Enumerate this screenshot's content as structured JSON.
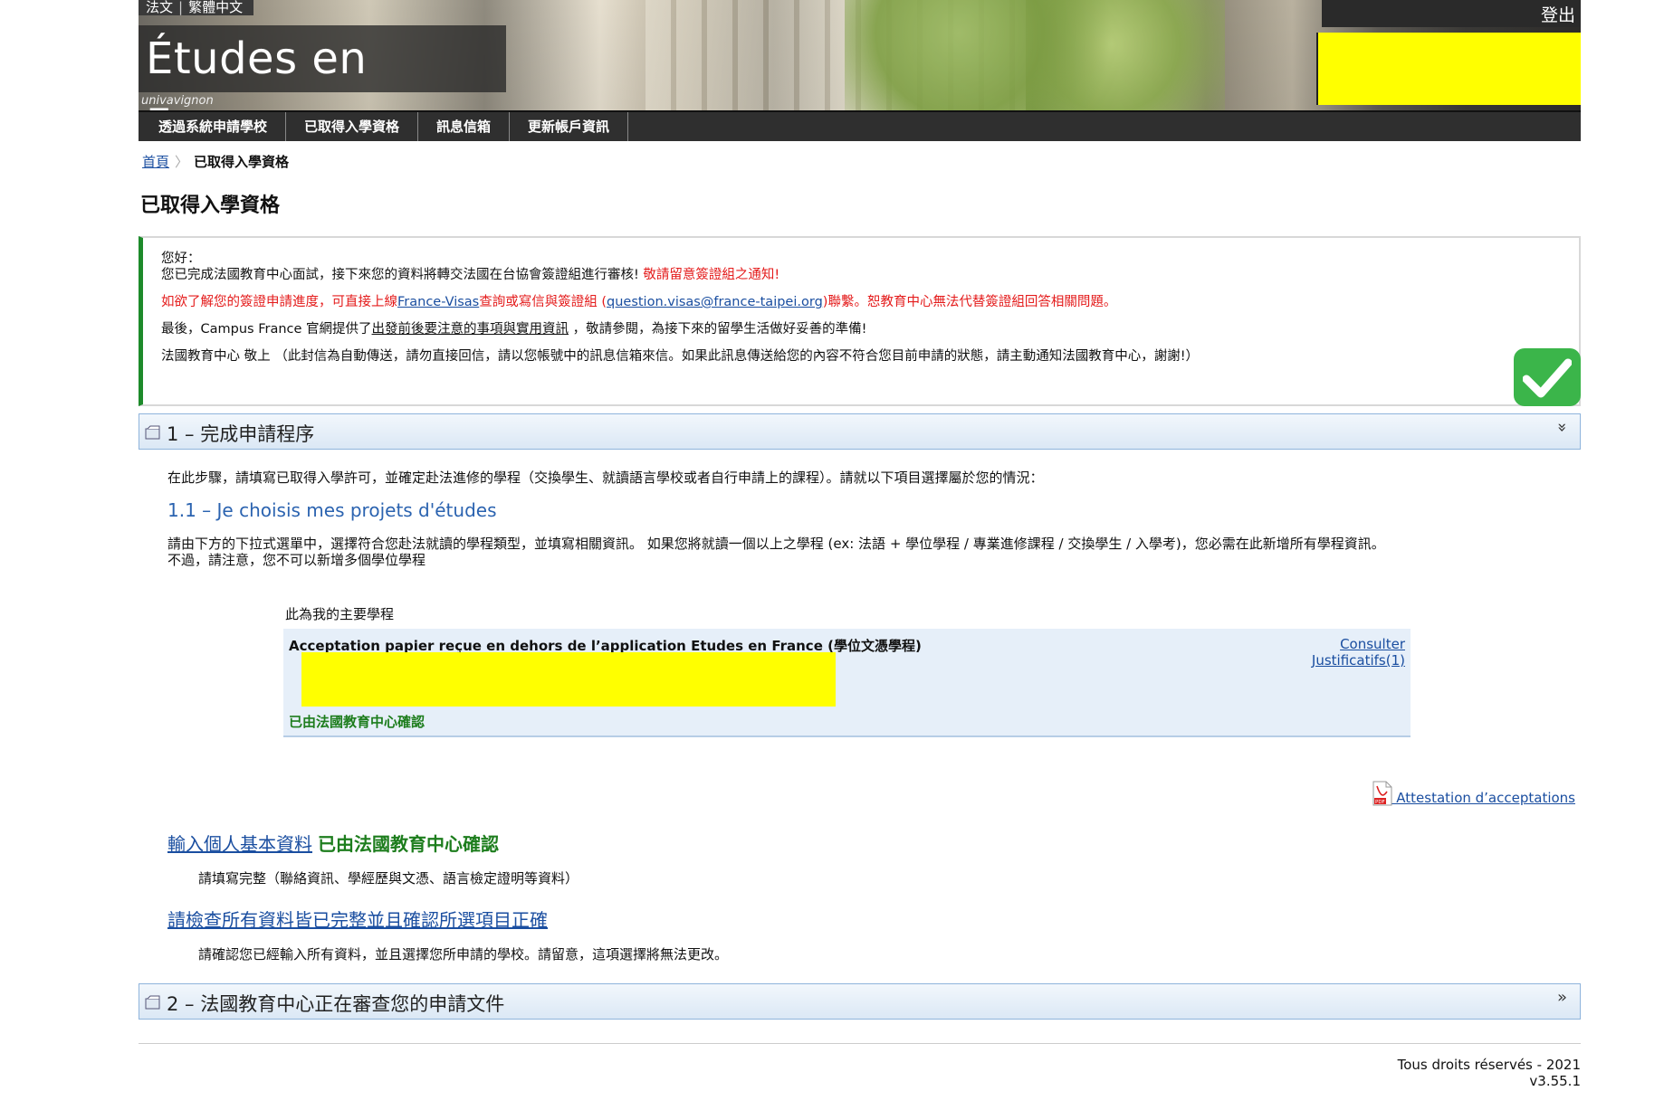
{
  "header": {
    "languages": [
      "法文",
      "繁體中文"
    ],
    "site_title": "Études en France",
    "site_subtitle": "univavignon",
    "logout_label": "登出"
  },
  "nav": {
    "items": [
      "透過系統申請學校",
      "已取得入學資格",
      "訊息信箱",
      "更新帳戶資訊"
    ]
  },
  "breadcrumb": {
    "home": "首頁",
    "current": "已取得入學資格"
  },
  "page_title": "已取得入學資格",
  "message": {
    "greeting": "您好：",
    "line1": "您已完成法國教育中心面試，接下來您的資料將轉交法國在台協會簽證組進行審核! ",
    "line1_red": "敬請留意簽證組之通知!",
    "line2_pre": "如欲了解您的簽證申請進度，可直接上線",
    "line2_link1": "France-Visas",
    "line2_mid": "查詢或寫信與簽證組 (",
    "line2_link2": "question.visas@france-taipei.org",
    "line2_post": ")聯繫。恕教育中心無法代替簽證組回答相關問題。",
    "line3_pre": "最後，Campus France 官網提供了",
    "line3_link": "出發前後要注意的事項與實用資訊",
    "line3_post": " ，敬請參閱，為接下來的留學生活做好妥善的準備!",
    "line4": "法國教育中心 敬上 （此封信為自動傳送，請勿直接回信，請以您帳號中的訊息信箱來信。如果此訊息傳送給您的內容不符合您目前申請的狀態，請主動通知法國教育中心，謝謝!）"
  },
  "section1": {
    "title": "1 – 完成申請程序",
    "chevron": "»",
    "intro": "在此步驟，請填寫已取得入學許可，並確定赴法進修的學程（交換學生、就讀語言學校或者自行申請上的課程）。請就以下項目選擇屬於您的情況：",
    "subheading": "1.1 – Je choisis mes projets d'études",
    "desc_line1": "請由下方的下拉式選單中，選擇符合您赴法就讀的學程類型，並填寫相關資訊。 如果您將就讀一個以上之學程 (ex: 法語 + 學位學程 / 專業進修課程 / 交換學生 / 入學考)，您必需在此新增所有學程資訊。",
    "desc_line2": "不過，請注意，您不可以新增多個學位學程",
    "main_program_label": "此為我的主要學程",
    "program": {
      "title": "Acceptation papier reçue en dehors de l’application Etudes en France (學位文憑學程)",
      "status": "已由法國教育中心確認",
      "link_consult": "Consulter",
      "link_justif": "Justificatifs(1)"
    },
    "attestation_link": " Attestation d’acceptations",
    "personal_info_link": "輸入個人基本資料",
    "personal_info_status": "已由法國教育中心確認",
    "personal_info_desc": "請填寫完整（聯絡資訊、學經歷與文憑、語言檢定證明等資料）",
    "check_link": "請檢查所有資料皆已完整並且確認所選項目正確",
    "check_desc": "請確認您已經輸入所有資料，並且選擇您所申請的學校。請留意，這項選擇將無法更改。"
  },
  "section2": {
    "title": "2 – 法國教育中心正在審查您的申請文件",
    "chevron": "»"
  },
  "footer": {
    "rights": "Tous droits réservés - 2021",
    "version": "v3.55.1"
  },
  "colors": {
    "accent_link": "#1a4ea0",
    "success_green": "#1d7d1d",
    "alert_red": "#e41b1b",
    "nav_bg": "#2f2f2f",
    "redaction_yellow": "#ffff00"
  }
}
